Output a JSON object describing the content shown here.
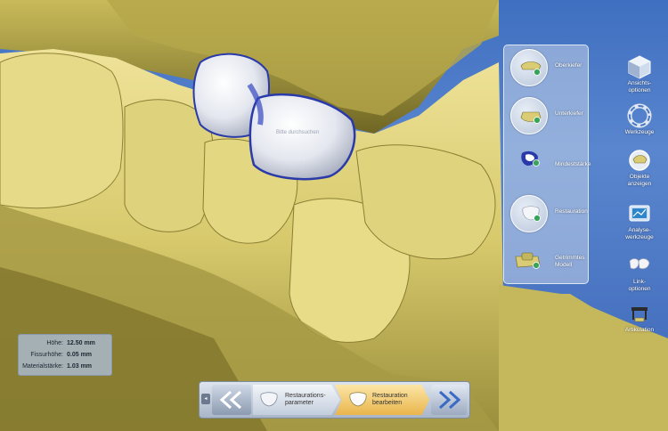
{
  "measurements": {
    "rows": [
      {
        "label": "Höhe:",
        "value": "12.50 mm"
      },
      {
        "label": "Fissurhöhe:",
        "value": "0.05 mm"
      },
      {
        "label": "Materialstärke:",
        "value": "1.03 mm"
      }
    ]
  },
  "viewport": {
    "overlay_text": "Bitte durchsuchen"
  },
  "object_panel": {
    "items": [
      {
        "label": "Oberkiefer",
        "icon": "upper-jaw-icon"
      },
      {
        "label": "Unterkiefer",
        "icon": "lower-jaw-icon"
      },
      {
        "label": "Mindeststärke",
        "icon": "minimum-thickness-icon"
      },
      {
        "label": "Restauration",
        "icon": "restoration-icon"
      },
      {
        "label": "Getrimmtes\nModell",
        "label_line1": "Getrimmtes",
        "label_line2": "Modell",
        "icon": "trimmed-model-icon"
      }
    ]
  },
  "toolbar": {
    "view_options": {
      "line1": "Ansichts-",
      "line2": "optionen",
      "icon": "view-cube-icon"
    },
    "tools": {
      "line1": "Werkzeuge",
      "icon": "tools-ring-icon"
    },
    "show_objects": {
      "line1": "Objekte",
      "line2": "anzeigen",
      "icon": "objects-icon"
    },
    "analysis_tools": {
      "line1": "Analyse-",
      "line2": "werkzeuge",
      "icon": "analysis-icon"
    },
    "link_options": {
      "line1": "Link-",
      "line2": "optionen",
      "icon": "link-teeth-icon"
    },
    "articulation": {
      "line1": "Artikulation",
      "icon": "articulator-icon"
    }
  },
  "bottom_nav": {
    "small_button": "◂",
    "step1": {
      "line1": "Restaurations-",
      "line2": "parameter"
    },
    "step2": {
      "line1": "Restauration",
      "line2": "bearbeiten"
    }
  },
  "colors": {
    "background_blue": "#4a78c4",
    "model_yellow": "#d9cc74",
    "restoration_white": "#eef0f4",
    "margin_blue": "#2a3aa8",
    "active_step_orange": "#eab54c"
  }
}
